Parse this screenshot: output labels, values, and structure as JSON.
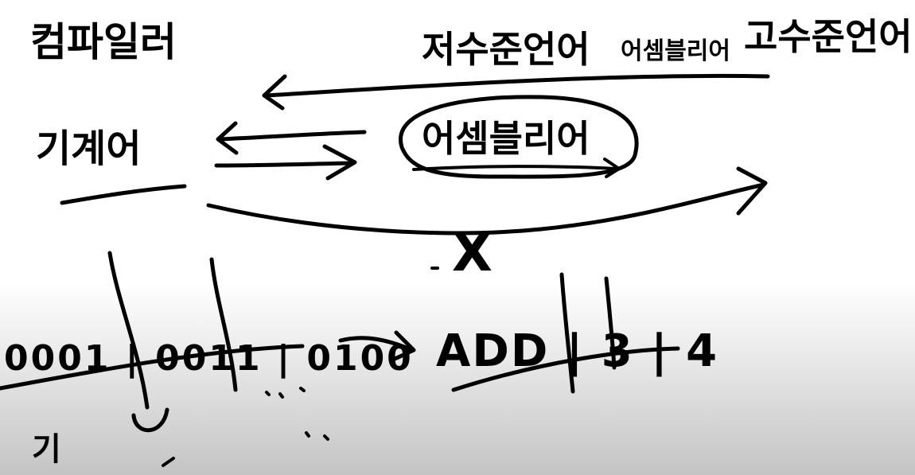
{
  "labels": {
    "compiler": "컴파일러",
    "low_level": "저수준언어",
    "assembly": "어셈블리어",
    "high_level": "고수준언어",
    "machine": "기계어",
    "not_possible": "X",
    "binary_code": "0001 | 0011 | 0100",
    "add_instruction": "ADD | 3 | 4",
    "opcode_hint": "기"
  },
  "colors": {
    "ink": "#000000",
    "background_top": "#ffffff",
    "background_bottom": "#c4c4c4"
  }
}
